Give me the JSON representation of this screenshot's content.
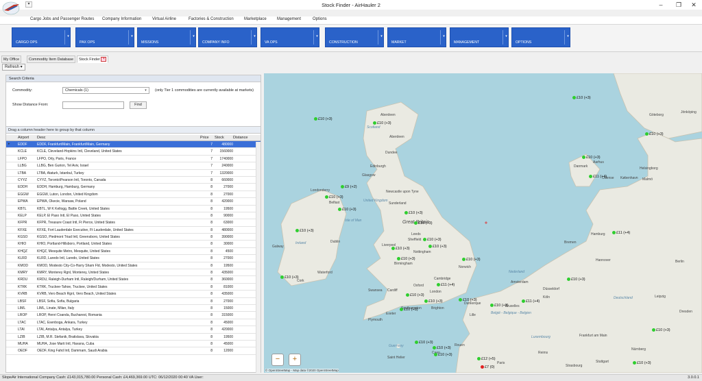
{
  "window": {
    "title": "Stock Finder - AirHauler 2"
  },
  "ribbon_tabs": [
    "Cargo Jobs and Passenger Routes",
    "Company Information",
    "Virtual Airline",
    "Factories & Construction",
    "Marketplace",
    "Management",
    "Options"
  ],
  "ribbon_buttons": [
    "CARGO OPS",
    "PAX OPS",
    "MISSIONS",
    "COMPANY INFO",
    "VA OPS",
    "CONSTRUCTION",
    "MARKET",
    "MANAGEMENT",
    "OPTIONS"
  ],
  "doc_tabs": [
    "My Office",
    "Commodity Item Database",
    "Stock Finder"
  ],
  "toolbar": {
    "refresh_label": "Refresh"
  },
  "search": {
    "header": "Search Criteria",
    "commodity_label": "Commodity:",
    "commodity_value": "Chemicals (1)",
    "tier_note": "(only Tier 1 commodities are currently available at markets)",
    "distance_label": "Show Distance From:",
    "distance_value": "",
    "find_label": "Find"
  },
  "grid": {
    "group_hint": "Drag a column header here to group by that column",
    "columns": [
      "Airport",
      "Desc",
      "Price",
      "Stock",
      "Distance"
    ],
    "rows": [
      [
        "EDDF",
        "EDDF, Frankfurt/Main, Frankfurt/Main, Germany",
        "7",
        "480000"
      ],
      [
        "KCLE",
        "KCLE, Cleveland-Hopkins Intl, Cleveland, United States",
        "7",
        "1560000"
      ],
      [
        "LFPO",
        "LFPO, Orly, Paris, France",
        "7",
        "1740000"
      ],
      [
        "LLBG",
        "LLBG, Ben Gurion, Tel Aviv, Israel",
        "7",
        "240000"
      ],
      [
        "LTBA",
        "LTBA, Ataturk, Istanbul, Turkey",
        "7",
        "1320000"
      ],
      [
        "CYYZ",
        "CYYZ, Toronto\\Pearson Intl, Toronto, Canada",
        "8",
        "660000"
      ],
      [
        "EDDH",
        "EDDH, Hamburg, Hamburg, Germany",
        "8",
        "27000"
      ],
      [
        "EGGW",
        "EGGW, Luton, London, United Kingdom",
        "8",
        "27000"
      ],
      [
        "EPWA",
        "EPWA, Okecie, Warsaw, Poland",
        "8",
        "420000"
      ],
      [
        "KBTL",
        "KBTL, W K Kellogg, Battle Creek, United States",
        "8",
        "19500"
      ],
      [
        "KELP",
        "KELP, El Paso Intl, El Paso, United States",
        "8",
        "90000"
      ],
      [
        "KFPR",
        "KFPR, Treasure Coast Intl, Ft Pierce, United States",
        "8",
        "63000"
      ],
      [
        "KFXE",
        "KFXE, Fort Lauderdale Executive, Ft Lauderdale, United States",
        "8",
        "480000"
      ],
      [
        "KGSO",
        "KGSO, Piedmont Triad Intl, Greensboro, United States",
        "8",
        "390000"
      ],
      [
        "KHIO",
        "KHIO, Portland-Hillsboro, Portland, United States",
        "8",
        "30000"
      ],
      [
        "KHQZ",
        "KHQZ, Mesquite Metro, Mesquite, United States",
        "8",
        "4500"
      ],
      [
        "KLRD",
        "KLRD, Laredo Intl, Laredo, United States",
        "8",
        "27000"
      ],
      [
        "KMOD",
        "KMOD, Modesto City-Co-Harry Sham Fld, Modesto, United States",
        "8",
        "19500"
      ],
      [
        "KMRY",
        "KMRY, Monterey Rgnl, Monterey, United States",
        "8",
        "435000"
      ],
      [
        "KRDU",
        "KRDU, Raleigh-Durham Intl, Raleigh/Durham, United States",
        "8",
        "360000"
      ],
      [
        "KTRK",
        "KTRK, Truckee-Tahoe, Truckee, United States",
        "8",
        "81000"
      ],
      [
        "KVRB",
        "KVRB, Vero Beach Rgnl, Vero Beach, United States",
        "8",
        "435000"
      ],
      [
        "LBSF",
        "LBSF, Sofia, Sofia, Bulgaria",
        "8",
        "27000"
      ],
      [
        "LIML",
        "LIML, Linate, Milan, Italy",
        "8",
        "15000"
      ],
      [
        "LROP",
        "LROP, Henri Coanda, Bucharest, Romania",
        "8",
        "315000"
      ],
      [
        "LTAC",
        "LTAC, Esenboga, Ankara, Turkey",
        "8",
        "45000"
      ],
      [
        "LTAI",
        "LTAI, Antalya, Antalya, Turkey",
        "8",
        "420000"
      ],
      [
        "LZIB",
        "LZIB, M.R. Stefanik, Bratislava, Slovakia",
        "8",
        "19500"
      ],
      [
        "MUHA",
        "MUHA, Jose Marti Intl, Havana, Cuba",
        "8",
        "45000"
      ],
      [
        "OEDF",
        "OEDF, King Fahd Intl, Dammam, Saudi Arabia",
        "8",
        "12000"
      ]
    ]
  },
  "map": {
    "credit": "© OpenStreetMap - Map data ©2020 OpenStreetMap",
    "markers": [
      "£10 (+3)",
      "£10 (+3)",
      "£9 (+2)",
      "£10 (+3)",
      "£10 (+3)",
      "£10 (+3)",
      "£10 (+3)",
      "£10 (+3)",
      "£10 (+3)",
      "£10 (+3)",
      "£10 (+3)",
      "£10 (+3)",
      "£10 (+3)",
      "£10 (+3)",
      "£11 (+4)",
      "£10 (+3)",
      "£10 (+3)",
      "£10 (+3)",
      "£11 (+4)",
      "£10 (+3)",
      "£10 (+3)",
      "£10 (+3)",
      "£10 (+3)",
      "£10 (+3)",
      "£7 (0)",
      "£12 (+5)",
      "£10 (+3)",
      "£10 (+3)",
      "£11 (+4)",
      "£10 (+3)",
      "£11 (+4)",
      "£10 (+3)",
      "£10 (+3)",
      "£10 (+3)"
    ],
    "places": [
      "Aberdeen",
      "Dundee",
      "Edinburgh",
      "Glasgow",
      "Newcastle upon Tyne",
      "Sunderland",
      "United Kingdom",
      "Isle of Man",
      "Great Britain",
      "Leeds",
      "Liverpool",
      "Sheffield",
      "Nottingham",
      "Birmingham",
      "Norwich",
      "Cambridge",
      "Oxford",
      "Cardiff",
      "Swansea",
      "London",
      "Southampton",
      "Brighton",
      "Plymouth",
      "Exeter",
      "Ireland",
      "Dublin",
      "Belfast",
      "Londonderry",
      "Galway",
      "Cork",
      "Waterford",
      "Guernsey",
      "Saint Helier",
      "Danmark",
      "København",
      "Aarhus",
      "Odense",
      "Hamburg",
      "Bremen",
      "Berlin",
      "Hannover",
      "Nederland",
      "Amsterdam",
      "Deutschland",
      "Düsseldorf",
      "Köln",
      "Frankfurt am Main",
      "België - Belgique - Belgien",
      "Bruxelles",
      "Lille",
      "Luxembourg",
      "Paris",
      "Stuttgart",
      "Nürnberg",
      "Strasbourg",
      "Leipzig",
      "Dresden",
      "Göteborg",
      "Malmö",
      "Helsingborg",
      "Jönköping",
      "Aberdeen",
      "Scotland",
      "Dunkerque",
      "Rouen",
      "Caen",
      "Reims"
    ],
    "zoom_out": "−",
    "zoom_in": "+"
  },
  "status": {
    "text": "SlopeAir International   Company Cash: £143,015,780.00   Personal Cash: £4,469,369.00   UTC: 06/12/2020  00:40   VA User:",
    "version": "3.0.0.1"
  },
  "colors": {
    "ribbon_button": "#2a62c9",
    "selected_row": "#3a6fd8",
    "marker": "#2fce2f",
    "marker_alert": "#e02020",
    "sea": "#aad3df",
    "land": "#eaeae2"
  }
}
